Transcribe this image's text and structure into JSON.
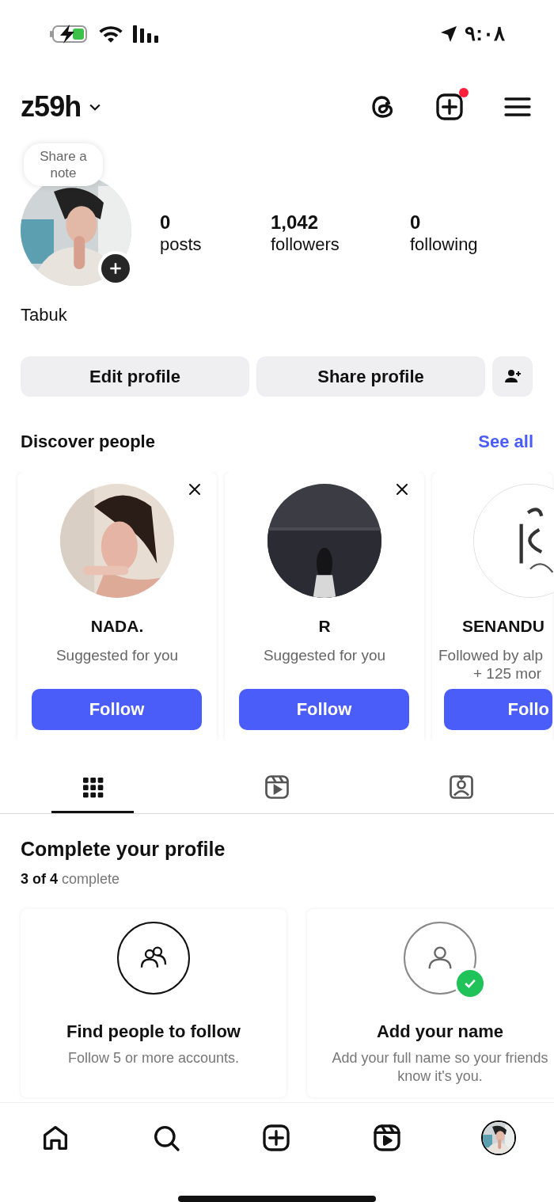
{
  "status_bar": {
    "time": "٩:٠٨"
  },
  "header": {
    "username": "z59h",
    "new_post_badge": true
  },
  "profile": {
    "note": "Share a note",
    "stats": [
      {
        "value": "0",
        "label": "posts"
      },
      {
        "value": "1,042",
        "label": "followers"
      },
      {
        "value": "0",
        "label": "following"
      }
    ],
    "bio": "Tabuk"
  },
  "actions": [
    "Edit profile",
    "Share profile"
  ],
  "discover": {
    "title": "Discover people",
    "see_all": "See all",
    "cards": [
      {
        "kind": "full",
        "name": "NADA.",
        "subtitle": "Suggested for you",
        "button": "Follow",
        "dismissible": true
      },
      {
        "kind": "full",
        "name": "R",
        "subtitle": "Suggested for you",
        "button": "Follow",
        "dismissible": true
      },
      {
        "kind": "partial",
        "name": "SENANDU",
        "subtitle": "Followed by alp",
        "subtitle_2": "+ 125 mor",
        "button": "Follo",
        "dismissible": false
      }
    ]
  },
  "tabs": [
    {
      "kind": "grid",
      "selected": true
    },
    {
      "kind": "reels",
      "selected": false
    },
    {
      "kind": "tagged",
      "selected": false
    }
  ],
  "complete_profile": {
    "title": "Complete your profile",
    "progress": "**3 of 4** complete",
    "cards": [
      {
        "kind": "people",
        "title": "Find people to follow",
        "description": "Follow 5 or more accounts.",
        "done": false
      },
      {
        "kind": "name",
        "title": "Add your name",
        "description": "Add your full name so your friends know it's you.",
        "done": true
      }
    ]
  },
  "nav": [
    {
      "kind": "home"
    },
    {
      "kind": "search"
    },
    {
      "kind": "create"
    },
    {
      "kind": "reels"
    },
    {
      "kind": "profile"
    }
  ]
}
